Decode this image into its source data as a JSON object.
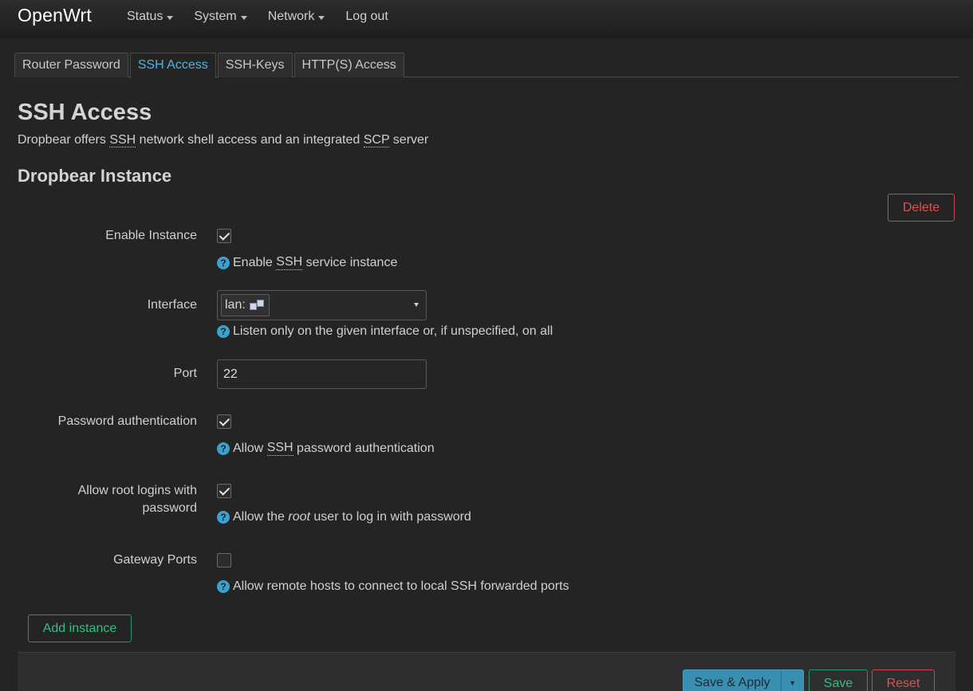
{
  "topbar": {
    "brand": "OpenWrt",
    "menu": [
      {
        "label": "Status",
        "dropdown": true
      },
      {
        "label": "System",
        "dropdown": true
      },
      {
        "label": "Network",
        "dropdown": true
      },
      {
        "label": "Log out",
        "dropdown": false
      }
    ]
  },
  "tabs": [
    {
      "label": "Router Password",
      "active": false
    },
    {
      "label": "SSH Access",
      "active": true
    },
    {
      "label": "SSH-Keys",
      "active": false
    },
    {
      "label": "HTTP(S) Access",
      "active": false
    }
  ],
  "page": {
    "title": "SSH Access",
    "desc_prefix": "Dropbear offers ",
    "desc_abbr1": "SSH",
    "desc_middle": " network shell access and an integrated ",
    "desc_abbr2": "SCP",
    "desc_suffix": " server"
  },
  "section": {
    "title": "Dropbear Instance",
    "delete_label": "Delete"
  },
  "fields": {
    "enable_instance": {
      "label": "Enable Instance",
      "checked": true,
      "help_prefix": "Enable ",
      "help_abbr": "SSH",
      "help_suffix": " service instance"
    },
    "interface": {
      "label": "Interface",
      "value": "lan:",
      "help": "Listen only on the given interface or, if unspecified, on all"
    },
    "port": {
      "label": "Port",
      "value": "22"
    },
    "password_auth": {
      "label": "Password authentication",
      "checked": true,
      "help_prefix": "Allow ",
      "help_abbr": "SSH",
      "help_suffix": " password authentication"
    },
    "root_password": {
      "label_line1": "Allow root logins with",
      "label_line2": "password",
      "checked": true,
      "help_prefix": "Allow the ",
      "help_italic": "root",
      "help_suffix": " user to log in with password"
    },
    "gateway_ports": {
      "label": "Gateway Ports",
      "checked": false,
      "help": "Allow remote hosts to connect to local SSH forwarded ports"
    }
  },
  "add_instance_label": "Add instance",
  "footer": {
    "save_apply_label": "Save & Apply",
    "save_label": "Save",
    "reset_label": "Reset"
  },
  "icons": {
    "help": "question-circle-icon",
    "network": "network-interface-icon",
    "caret": "caret-down-icon",
    "check": "checkmark-icon"
  },
  "colors": {
    "accent": "#4fb4e0",
    "danger": "#d9534f",
    "success": "#2fbf84",
    "primary": "#3a8fb0"
  }
}
